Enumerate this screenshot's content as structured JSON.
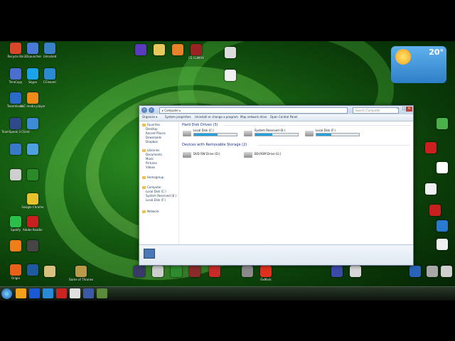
{
  "desktop": {
    "icons": [
      {
        "label": "Recycle Bin",
        "color": "#d9472b"
      },
      {
        "label": "3DLauncher",
        "color": "#4a7ad8"
      },
      {
        "label": "Unlocked",
        "color": "#3a80c8"
      },
      {
        "label": "TeraCopy",
        "color": "#4a6fd0"
      },
      {
        "label": "Skype",
        "color": "#1aa3e8"
      },
      {
        "label": "CCleaner",
        "color": "#2c8ad0"
      },
      {
        "label": "",
        "color": "#5a3bc0"
      },
      {
        "label": "",
        "color": "#e6c85c"
      },
      {
        "label": "",
        "color": "#e8822a"
      },
      {
        "label": "CS CLIMAX",
        "color": "#9b2222"
      },
      {
        "label": "",
        "color": "#dcdcdc"
      },
      {
        "label": "",
        "color": "#f0f0f0"
      },
      {
        "label": "TeamViewer",
        "color": "#2a6ac8"
      },
      {
        "label": "VLC media player",
        "color": "#f08a1a"
      },
      {
        "label": "TeamSpeak 3 Client",
        "color": "#2e4a8a"
      },
      {
        "label": "",
        "color": "#3d8bd6"
      },
      {
        "label": "",
        "color": "#3a78c8"
      },
      {
        "label": "",
        "color": "#4fa0e0"
      },
      {
        "label": "",
        "color": "#cfcfcf"
      },
      {
        "label": "",
        "color": "#2a8a2a"
      },
      {
        "label": "Google Chrome",
        "color": "#e8c22a"
      },
      {
        "label": "Spotify",
        "color": "#2bbf4a"
      },
      {
        "label": "Adobe Reader",
        "color": "#c8201f"
      },
      {
        "label": "",
        "color": "#ef7d1a"
      },
      {
        "label": "",
        "color": "#454545"
      },
      {
        "label": "Origin",
        "color": "#e8611a"
      },
      {
        "label": "",
        "color": "#1d5aa0"
      },
      {
        "label": "",
        "color": "#d8c080"
      },
      {
        "label": "Game of Thrones",
        "color": "#b89a4a"
      },
      {
        "label": "",
        "color": "#3a3a6a"
      },
      {
        "label": "",
        "color": "#cfcfcf"
      },
      {
        "label": "",
        "color": "#2e8c2e"
      },
      {
        "label": "",
        "color": "#8c2a2a"
      },
      {
        "label": "",
        "color": "#c82a2a"
      },
      {
        "label": "",
        "color": "#8a8a8a"
      },
      {
        "label": "FixMark",
        "color": "#e0301e"
      },
      {
        "label": "",
        "color": "#3a4aa8"
      },
      {
        "label": "",
        "color": "#d8d8d8"
      },
      {
        "label": "",
        "color": "#2a62b8"
      },
      {
        "label": "",
        "color": "#a8a8a8"
      },
      {
        "label": "",
        "color": "#cfcfcf"
      },
      {
        "label": "",
        "color": "#4ab04a"
      },
      {
        "label": "",
        "color": "#cc2020"
      },
      {
        "label": "",
        "color": "#ffffff"
      },
      {
        "label": "",
        "color": "#f0f0f0"
      },
      {
        "label": "",
        "color": "#c82020"
      },
      {
        "label": "",
        "color": "#2a7ad0"
      },
      {
        "label": "",
        "color": "#f0f0f0"
      }
    ]
  },
  "weather": {
    "temp": "20°",
    "line1": "",
    "line2": ""
  },
  "explorer": {
    "address": "▸ Computer ▸",
    "search_placeholder": "Search Computer",
    "toolbar": [
      "Organize ▾",
      "System properties",
      "Uninstall or change a program",
      "Map network drive",
      "Open Control Panel"
    ],
    "nav": {
      "favorites": "Favorites",
      "fav_items": [
        "Desktop",
        "Recent Places",
        "Downloads",
        "Dropbox"
      ],
      "libraries": "Libraries",
      "lib_items": [
        "Documents",
        "Music",
        "Pictures",
        "Videos"
      ],
      "homegroup": "Homegroup",
      "computer": "Computer",
      "comp_items": [
        "Local Disk (C:)",
        "System Reserved (E:)",
        "Local Disk (F:)"
      ],
      "network": "Network"
    },
    "groups": {
      "hdd": "Hard Disk Drives (3)",
      "removable": "Devices with Removable Storage (2)"
    },
    "drives": [
      {
        "name": "Local Disk (C:)",
        "free": 0.55,
        "space": ""
      },
      {
        "name": "System Reserved (E:)",
        "free": 0.4,
        "space": ""
      },
      {
        "name": "Local Disk (F:)",
        "free": 0.35,
        "space": ""
      }
    ],
    "removable": [
      {
        "name": "DVD RW Drive (D:)"
      },
      {
        "name": "BD-ROM Drive (G:)"
      }
    ],
    "details": {
      "pc_name": "",
      "workgroup": "",
      "processor": "",
      "memory": ""
    }
  },
  "taskbar": {
    "colors": [
      "#f0a21a",
      "#1a5ad8",
      "#2a8ad8",
      "#cc2222",
      "#e0e0e0",
      "#3a5aa8",
      "#5a8a3a"
    ],
    "time": "",
    "date": ""
  }
}
